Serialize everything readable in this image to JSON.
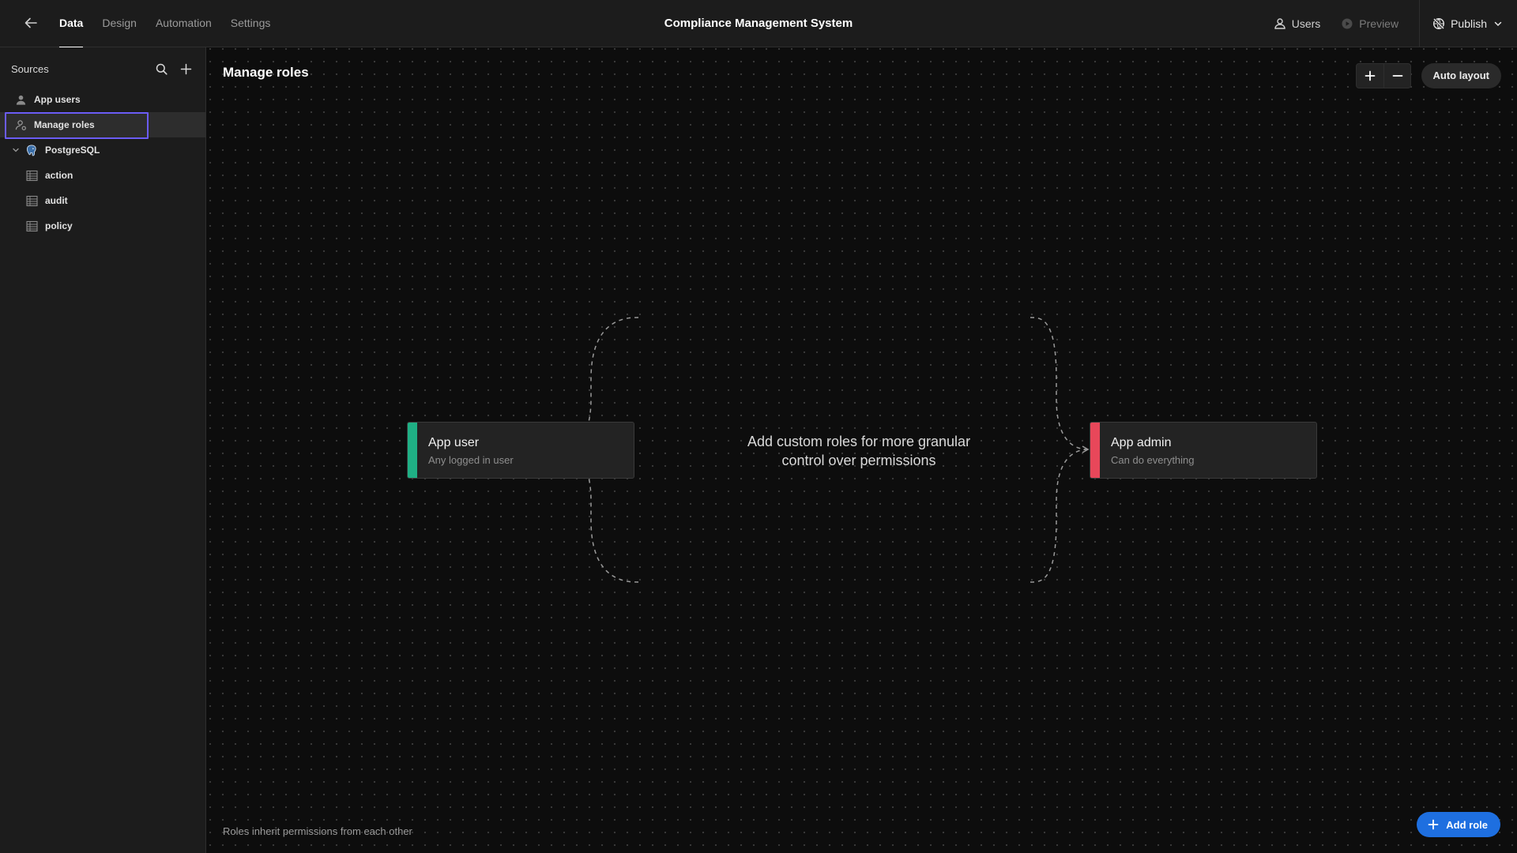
{
  "app_title": "Compliance Management System",
  "nav": {
    "tabs": [
      {
        "label": "Data",
        "active": true
      },
      {
        "label": "Design",
        "active": false
      },
      {
        "label": "Automation",
        "active": false
      },
      {
        "label": "Settings",
        "active": false
      }
    ]
  },
  "top_right": {
    "users_label": "Users",
    "preview_label": "Preview",
    "publish_label": "Publish"
  },
  "sidebar": {
    "title": "Sources",
    "items": [
      {
        "label": "App users",
        "icon": "user-icon"
      },
      {
        "label": "Manage roles",
        "icon": "manage-roles-icon",
        "selected": true
      },
      {
        "label": "PostgreSQL",
        "icon": "postgresql-icon",
        "expanded": true
      },
      {
        "label": "action",
        "icon": "table-icon"
      },
      {
        "label": "audit",
        "icon": "table-icon"
      },
      {
        "label": "policy",
        "icon": "table-icon"
      }
    ]
  },
  "canvas": {
    "title": "Manage roles",
    "auto_layout_label": "Auto layout",
    "roles": [
      {
        "name": "App user",
        "description": "Any logged in user",
        "color": "#1fb085"
      },
      {
        "name": "App admin",
        "description": "Can do everything",
        "color": "#e8475a"
      }
    ],
    "center_message": "Add custom roles for more granular control over permissions",
    "footnote": "Roles inherit permissions from each other",
    "add_role_label": "Add role"
  },
  "colors": {
    "accent": "#1e6fe0",
    "selection_outline": "#6b5cf6",
    "background": "#0d0d0d",
    "panel": "#1c1c1c"
  }
}
